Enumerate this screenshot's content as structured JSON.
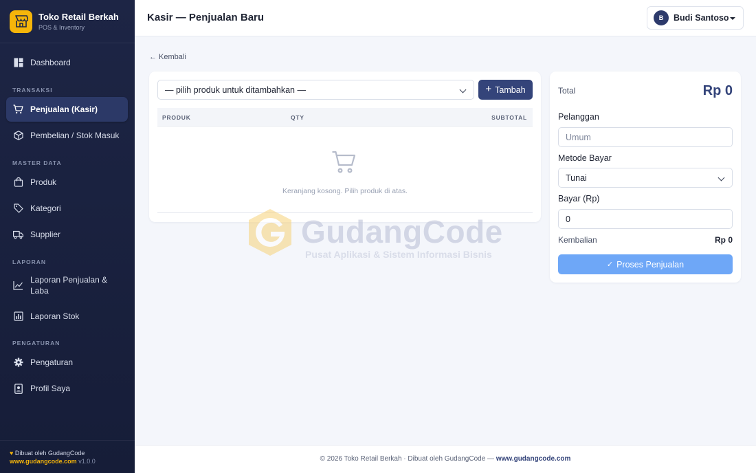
{
  "brand": {
    "name": "Toko Retail Berkah",
    "subtitle": "POS & Inventory",
    "icon": "store-icon"
  },
  "sidebar": {
    "dashboard": {
      "label": "Dashboard",
      "icon": "dashboard-icon"
    },
    "sections": {
      "transaksi": "TRANSAKSI",
      "master": "MASTER DATA",
      "laporan": "LAPORAN",
      "pengaturan": "PENGATURAN"
    },
    "items": {
      "penjualan": {
        "label": "Penjualan (Kasir)",
        "icon": "cart-icon",
        "active": true
      },
      "pembelian": {
        "label": "Pembelian / Stok Masuk",
        "icon": "box-icon"
      },
      "produk": {
        "label": "Produk",
        "icon": "bag-icon"
      },
      "kategori": {
        "label": "Kategori",
        "icon": "tag-icon"
      },
      "supplier": {
        "label": "Supplier",
        "icon": "truck-icon"
      },
      "laporan_penjualan": {
        "label": "Laporan Penjualan & Laba",
        "icon": "line-chart-icon"
      },
      "laporan_stok": {
        "label": "Laporan Stok",
        "icon": "bar-chart-icon"
      },
      "pengaturan": {
        "label": "Pengaturan",
        "icon": "gear-icon"
      },
      "profil": {
        "label": "Profil Saya",
        "icon": "id-card-icon"
      }
    },
    "footer": {
      "made_by": "Dibuat oleh GudangCode",
      "site": "www.gudangcode.com",
      "version": "v1.0.0"
    }
  },
  "header": {
    "title": "Kasir — Penjualan Baru",
    "user": {
      "initial": "B",
      "name": "Budi Santoso"
    }
  },
  "back_link": "← Kembali",
  "cart": {
    "product_select": "— pilih produk untuk ditambahkan —",
    "add_button": "Tambah",
    "columns": [
      "PRODUK",
      "QTY",
      "SUBTOTAL"
    ],
    "empty_message": "Keranjang kosong. Pilih produk di atas."
  },
  "summary": {
    "total_label": "Total",
    "total_value": "Rp 0",
    "customer_label": "Pelanggan",
    "customer_placeholder": "Umum",
    "method_label": "Metode Bayar",
    "method_value": "Tunai",
    "pay_label": "Bayar (Rp)",
    "pay_value": "0",
    "change_label": "Kembalian",
    "change_value": "Rp 0",
    "process_button": "Proses Penjualan"
  },
  "watermark": {
    "title": "GudangCode",
    "subtitle": "Pusat Aplikasi & Sistem Informasi Bisnis"
  },
  "footer": {
    "text": "© 2026 Toko Retail Berkah · Dibuat oleh GudangCode — ",
    "link": "www.gudangcode.com"
  },
  "colors": {
    "sidebar_bg": "#1d2545",
    "accent": "#34447a",
    "brand_yellow": "#f5b50a",
    "process_button": "#6ea7f7"
  }
}
